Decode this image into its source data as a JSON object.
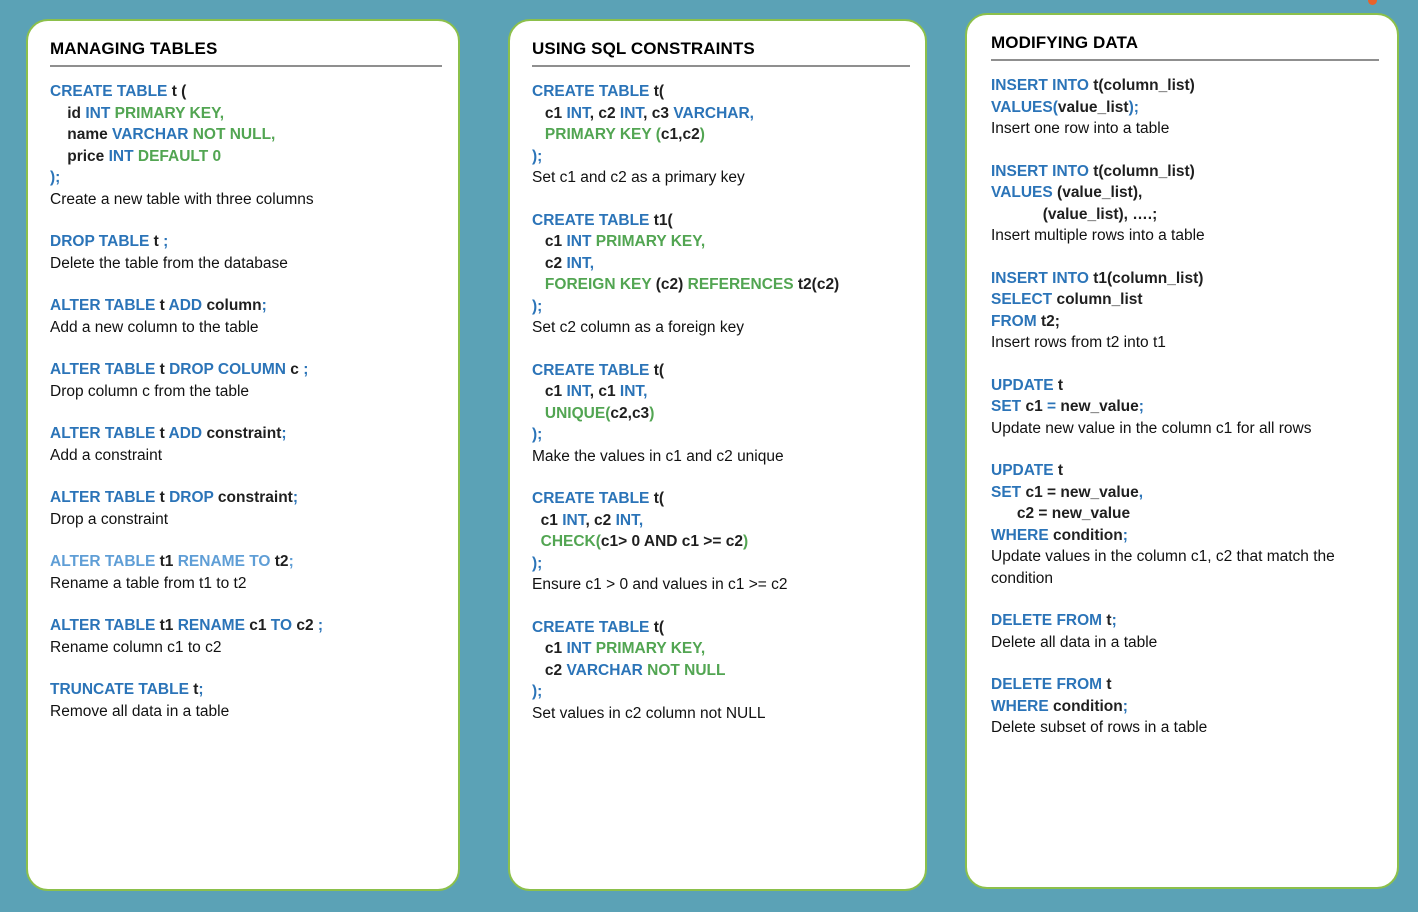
{
  "page": {
    "background_color": "#5ba2b6",
    "card_border_color": "#8cc04b",
    "keyword_blue": "#2b74b8",
    "keyword_green": "#52a552",
    "keyword_light_blue": "#5f9ed6",
    "identifier_color": "#1f1f1f",
    "rule_color": "#8f8f8f"
  },
  "cursor": {
    "name": "cursor-dot",
    "color": "#e8622a"
  },
  "cards": [
    {
      "title": "MANAGING TABLES",
      "blocks": [
        {
          "lines": [
            [
              {
                "t": "CREATE TABLE ",
                "c": "kw"
              },
              {
                "t": "t (",
                "c": "id"
              }
            ],
            [
              {
                "t": "    id ",
                "c": "id"
              },
              {
                "t": "INT ",
                "c": "kw"
              },
              {
                "t": "PRIMARY KEY,",
                "c": "kw2"
              }
            ],
            [
              {
                "t": "    name ",
                "c": "id"
              },
              {
                "t": "VARCHAR ",
                "c": "kw"
              },
              {
                "t": "NOT NULL,",
                "c": "kw2"
              }
            ],
            [
              {
                "t": "    price ",
                "c": "id"
              },
              {
                "t": "INT ",
                "c": "kw"
              },
              {
                "t": "DEFAULT 0",
                "c": "kw2"
              }
            ],
            [
              {
                "t": ");",
                "c": "kw"
              }
            ]
          ],
          "desc": "Create a new table with three columns"
        },
        {
          "lines": [
            [
              {
                "t": "DROP TABLE ",
                "c": "kw"
              },
              {
                "t": "t ",
                "c": "id"
              },
              {
                "t": ";",
                "c": "kw"
              }
            ]
          ],
          "desc": "Delete the table from the database"
        },
        {
          "lines": [
            [
              {
                "t": "ALTER TABLE ",
                "c": "kw"
              },
              {
                "t": "t ",
                "c": "id"
              },
              {
                "t": "ADD ",
                "c": "kw"
              },
              {
                "t": "column",
                "c": "id"
              },
              {
                "t": ";",
                "c": "kw"
              }
            ]
          ],
          "desc": "Add a new column to the table"
        },
        {
          "lines": [
            [
              {
                "t": "ALTER TABLE ",
                "c": "kw"
              },
              {
                "t": "t ",
                "c": "id"
              },
              {
                "t": "DROP COLUMN ",
                "c": "kw"
              },
              {
                "t": "c ",
                "c": "id"
              },
              {
                "t": ";",
                "c": "kw"
              }
            ]
          ],
          "desc": "Drop column c from the table"
        },
        {
          "lines": [
            [
              {
                "t": "ALTER TABLE ",
                "c": "kw"
              },
              {
                "t": "t ",
                "c": "id"
              },
              {
                "t": "ADD ",
                "c": "kw"
              },
              {
                "t": "constraint",
                "c": "id"
              },
              {
                "t": ";",
                "c": "kw"
              }
            ]
          ],
          "desc": "Add a constraint"
        },
        {
          "lines": [
            [
              {
                "t": "ALTER TABLE ",
                "c": "kw"
              },
              {
                "t": "t ",
                "c": "id"
              },
              {
                "t": "DROP ",
                "c": "kw"
              },
              {
                "t": "constraint",
                "c": "id"
              },
              {
                "t": ";",
                "c": "kw"
              }
            ]
          ],
          "desc": "Drop a constraint"
        },
        {
          "lines": [
            [
              {
                "t": "ALTER TABLE ",
                "c": "kwl"
              },
              {
                "t": "t1 ",
                "c": "id"
              },
              {
                "t": "RENAME TO ",
                "c": "kwl"
              },
              {
                "t": "t2",
                "c": "id"
              },
              {
                "t": ";",
                "c": "kwl"
              }
            ]
          ],
          "desc": "Rename a table from t1 to t2"
        },
        {
          "lines": [
            [
              {
                "t": "ALTER TABLE ",
                "c": "kw"
              },
              {
                "t": "t1 ",
                "c": "id"
              },
              {
                "t": "RENAME ",
                "c": "kw"
              },
              {
                "t": "c1 ",
                "c": "id"
              },
              {
                "t": "TO ",
                "c": "kw"
              },
              {
                "t": "c2 ",
                "c": "id"
              },
              {
                "t": ";",
                "c": "kw"
              }
            ]
          ],
          "desc": "Rename column c1 to c2"
        },
        {
          "lines": [
            [
              {
                "t": "TRUNCATE TABLE ",
                "c": "kw"
              },
              {
                "t": "t",
                "c": "id"
              },
              {
                "t": ";",
                "c": "kw"
              }
            ]
          ],
          "desc": "Remove all data in a table"
        }
      ]
    },
    {
      "title": "USING SQL CONSTRAINTS",
      "blocks": [
        {
          "lines": [
            [
              {
                "t": "CREATE TABLE ",
                "c": "kw"
              },
              {
                "t": "t(",
                "c": "id"
              }
            ],
            [
              {
                "t": "   c1 ",
                "c": "id"
              },
              {
                "t": "INT",
                "c": "kw"
              },
              {
                "t": ", c2 ",
                "c": "id"
              },
              {
                "t": "INT",
                "c": "kw"
              },
              {
                "t": ", c3 ",
                "c": "id"
              },
              {
                "t": "VARCHAR,",
                "c": "kw"
              }
            ],
            [
              {
                "t": "   PRIMARY KEY ",
                "c": "kw2"
              },
              {
                "t": "(",
                "c": "kw2"
              },
              {
                "t": "c1,c2",
                "c": "id"
              },
              {
                "t": ")",
                "c": "kw2"
              }
            ],
            [
              {
                "t": ");",
                "c": "kw"
              }
            ]
          ],
          "desc": "Set c1 and c2 as a primary key"
        },
        {
          "lines": [
            [
              {
                "t": "CREATE TABLE ",
                "c": "kw"
              },
              {
                "t": "t1(",
                "c": "id"
              }
            ],
            [
              {
                "t": "   c1 ",
                "c": "id"
              },
              {
                "t": "INT ",
                "c": "kw"
              },
              {
                "t": "PRIMARY KEY,",
                "c": "kw2"
              }
            ],
            [
              {
                "t": "   c2 ",
                "c": "id"
              },
              {
                "t": "INT,",
                "c": "kw"
              }
            ],
            [
              {
                "t": "   FOREIGN KEY ",
                "c": "kw2"
              },
              {
                "t": "(c2) ",
                "c": "id"
              },
              {
                "t": "REFERENCES ",
                "c": "kw2"
              },
              {
                "t": "t2(c2)",
                "c": "id"
              }
            ],
            [
              {
                "t": ");",
                "c": "kw"
              }
            ]
          ],
          "desc": "Set c2 column as a foreign key"
        },
        {
          "lines": [
            [
              {
                "t": "CREATE TABLE ",
                "c": "kw"
              },
              {
                "t": "t(",
                "c": "id"
              }
            ],
            [
              {
                "t": "   c1 ",
                "c": "id"
              },
              {
                "t": "INT",
                "c": "kw"
              },
              {
                "t": ", c1 ",
                "c": "id"
              },
              {
                "t": "INT,",
                "c": "kw"
              }
            ],
            [
              {
                "t": "   UNIQUE",
                "c": "kw2"
              },
              {
                "t": "(",
                "c": "kw2"
              },
              {
                "t": "c2,c3",
                "c": "id"
              },
              {
                "t": ")",
                "c": "kw2"
              }
            ],
            [
              {
                "t": ");",
                "c": "kw"
              }
            ]
          ],
          "desc": "Make the values in c1 and c2 unique"
        },
        {
          "lines": [
            [
              {
                "t": "CREATE TABLE ",
                "c": "kw"
              },
              {
                "t": "t(",
                "c": "id"
              }
            ],
            [
              {
                "t": "  c1 ",
                "c": "id"
              },
              {
                "t": "INT",
                "c": "kw"
              },
              {
                "t": ", c2 ",
                "c": "id"
              },
              {
                "t": "INT,",
                "c": "kw"
              }
            ],
            [
              {
                "t": "  CHECK",
                "c": "kw2"
              },
              {
                "t": "(",
                "c": "kw2"
              },
              {
                "t": "c1> 0 AND c1 >= c2",
                "c": "id"
              },
              {
                "t": ")",
                "c": "kw2"
              }
            ],
            [
              {
                "t": ");",
                "c": "kw"
              }
            ]
          ],
          "desc": "Ensure c1 > 0 and values in c1 >= c2"
        },
        {
          "lines": [
            [
              {
                "t": "CREATE TABLE ",
                "c": "kw"
              },
              {
                "t": "t(",
                "c": "id"
              }
            ],
            [
              {
                "t": "   c1 ",
                "c": "id"
              },
              {
                "t": "INT ",
                "c": "kw"
              },
              {
                "t": "PRIMARY KEY,",
                "c": "kw2"
              }
            ],
            [
              {
                "t": "   c2 ",
                "c": "id"
              },
              {
                "t": "VARCHAR ",
                "c": "kw"
              },
              {
                "t": "NOT NULL",
                "c": "kw2"
              }
            ],
            [
              {
                "t": ");",
                "c": "kw"
              }
            ]
          ],
          "desc": "Set values in c2 column not NULL"
        }
      ]
    },
    {
      "title": "MODIFYING DATA",
      "blocks": [
        {
          "lines": [
            [
              {
                "t": "INSERT INTO ",
                "c": "kw"
              },
              {
                "t": "t(column_list)",
                "c": "id"
              }
            ],
            [
              {
                "t": "VALUES",
                "c": "kw"
              },
              {
                "t": "(",
                "c": "kw"
              },
              {
                "t": "value_list",
                "c": "id"
              },
              {
                "t": ");",
                "c": "kw"
              }
            ]
          ],
          "desc": "Insert one row into a table"
        },
        {
          "lines": [
            [
              {
                "t": "INSERT INTO ",
                "c": "kw"
              },
              {
                "t": "t(column_list)",
                "c": "id"
              }
            ],
            [
              {
                "t": "VALUES ",
                "c": "kw"
              },
              {
                "t": "(value_list),",
                "c": "id"
              }
            ],
            [
              {
                "t": "            (value_list), ….;",
                "c": "id"
              }
            ]
          ],
          "desc": "Insert multiple rows into a table"
        },
        {
          "lines": [
            [
              {
                "t": "INSERT INTO ",
                "c": "kw"
              },
              {
                "t": "t1(column_list)",
                "c": "id"
              }
            ],
            [
              {
                "t": "SELECT ",
                "c": "kw"
              },
              {
                "t": "column_list",
                "c": "id"
              }
            ],
            [
              {
                "t": "FROM ",
                "c": "kw"
              },
              {
                "t": "t2;",
                "c": "id"
              }
            ]
          ],
          "desc": "Insert rows from t2 into t1"
        },
        {
          "lines": [
            [
              {
                "t": "UPDATE ",
                "c": "kw"
              },
              {
                "t": "t",
                "c": "id"
              }
            ],
            [
              {
                "t": "SET ",
                "c": "kw"
              },
              {
                "t": "c1 ",
                "c": "id"
              },
              {
                "t": "= ",
                "c": "kw"
              },
              {
                "t": "new_value",
                "c": "id"
              },
              {
                "t": ";",
                "c": "kw"
              }
            ]
          ],
          "desc": "Update new value in the column c1 for all rows"
        },
        {
          "lines": [
            [
              {
                "t": "UPDATE ",
                "c": "kw"
              },
              {
                "t": "t",
                "c": "id"
              }
            ],
            [
              {
                "t": "SET ",
                "c": "kw"
              },
              {
                "t": "c1 = new_value",
                "c": "id"
              },
              {
                "t": ",",
                "c": "kw"
              }
            ],
            [
              {
                "t": "      c2 = new_value",
                "c": "id"
              }
            ],
            [
              {
                "t": "WHERE ",
                "c": "kw"
              },
              {
                "t": "condition",
                "c": "id"
              },
              {
                "t": ";",
                "c": "kw"
              }
            ]
          ],
          "desc": "Update values in the column c1, c2 that match the condition"
        },
        {
          "lines": [
            [
              {
                "t": "DELETE FROM ",
                "c": "kw"
              },
              {
                "t": "t",
                "c": "id"
              },
              {
                "t": ";",
                "c": "kw"
              }
            ]
          ],
          "desc": "Delete all data in a table"
        },
        {
          "lines": [
            [
              {
                "t": "DELETE FROM ",
                "c": "kw"
              },
              {
                "t": "t",
                "c": "id"
              }
            ],
            [
              {
                "t": "WHERE ",
                "c": "kw"
              },
              {
                "t": "condition",
                "c": "id"
              },
              {
                "t": ";",
                "c": "kw"
              }
            ]
          ],
          "desc": "Delete subset of rows in a table"
        }
      ]
    }
  ]
}
